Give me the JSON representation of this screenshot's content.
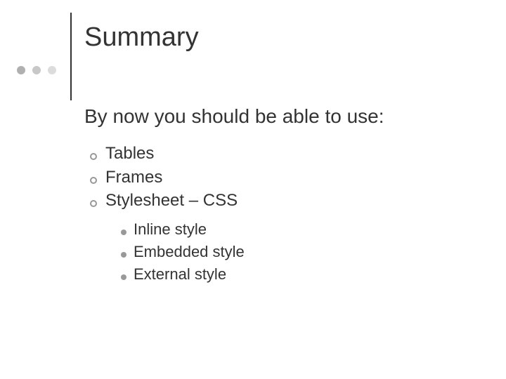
{
  "title": "Summary",
  "intro": "By now you should be able to use:",
  "bullets": {
    "level1": [
      {
        "text": "Tables"
      },
      {
        "text": "Frames"
      },
      {
        "text": "Stylesheet – CSS"
      }
    ],
    "level2": [
      {
        "text": "Inline style"
      },
      {
        "text": "Embedded style"
      },
      {
        "text": "External style"
      }
    ]
  }
}
